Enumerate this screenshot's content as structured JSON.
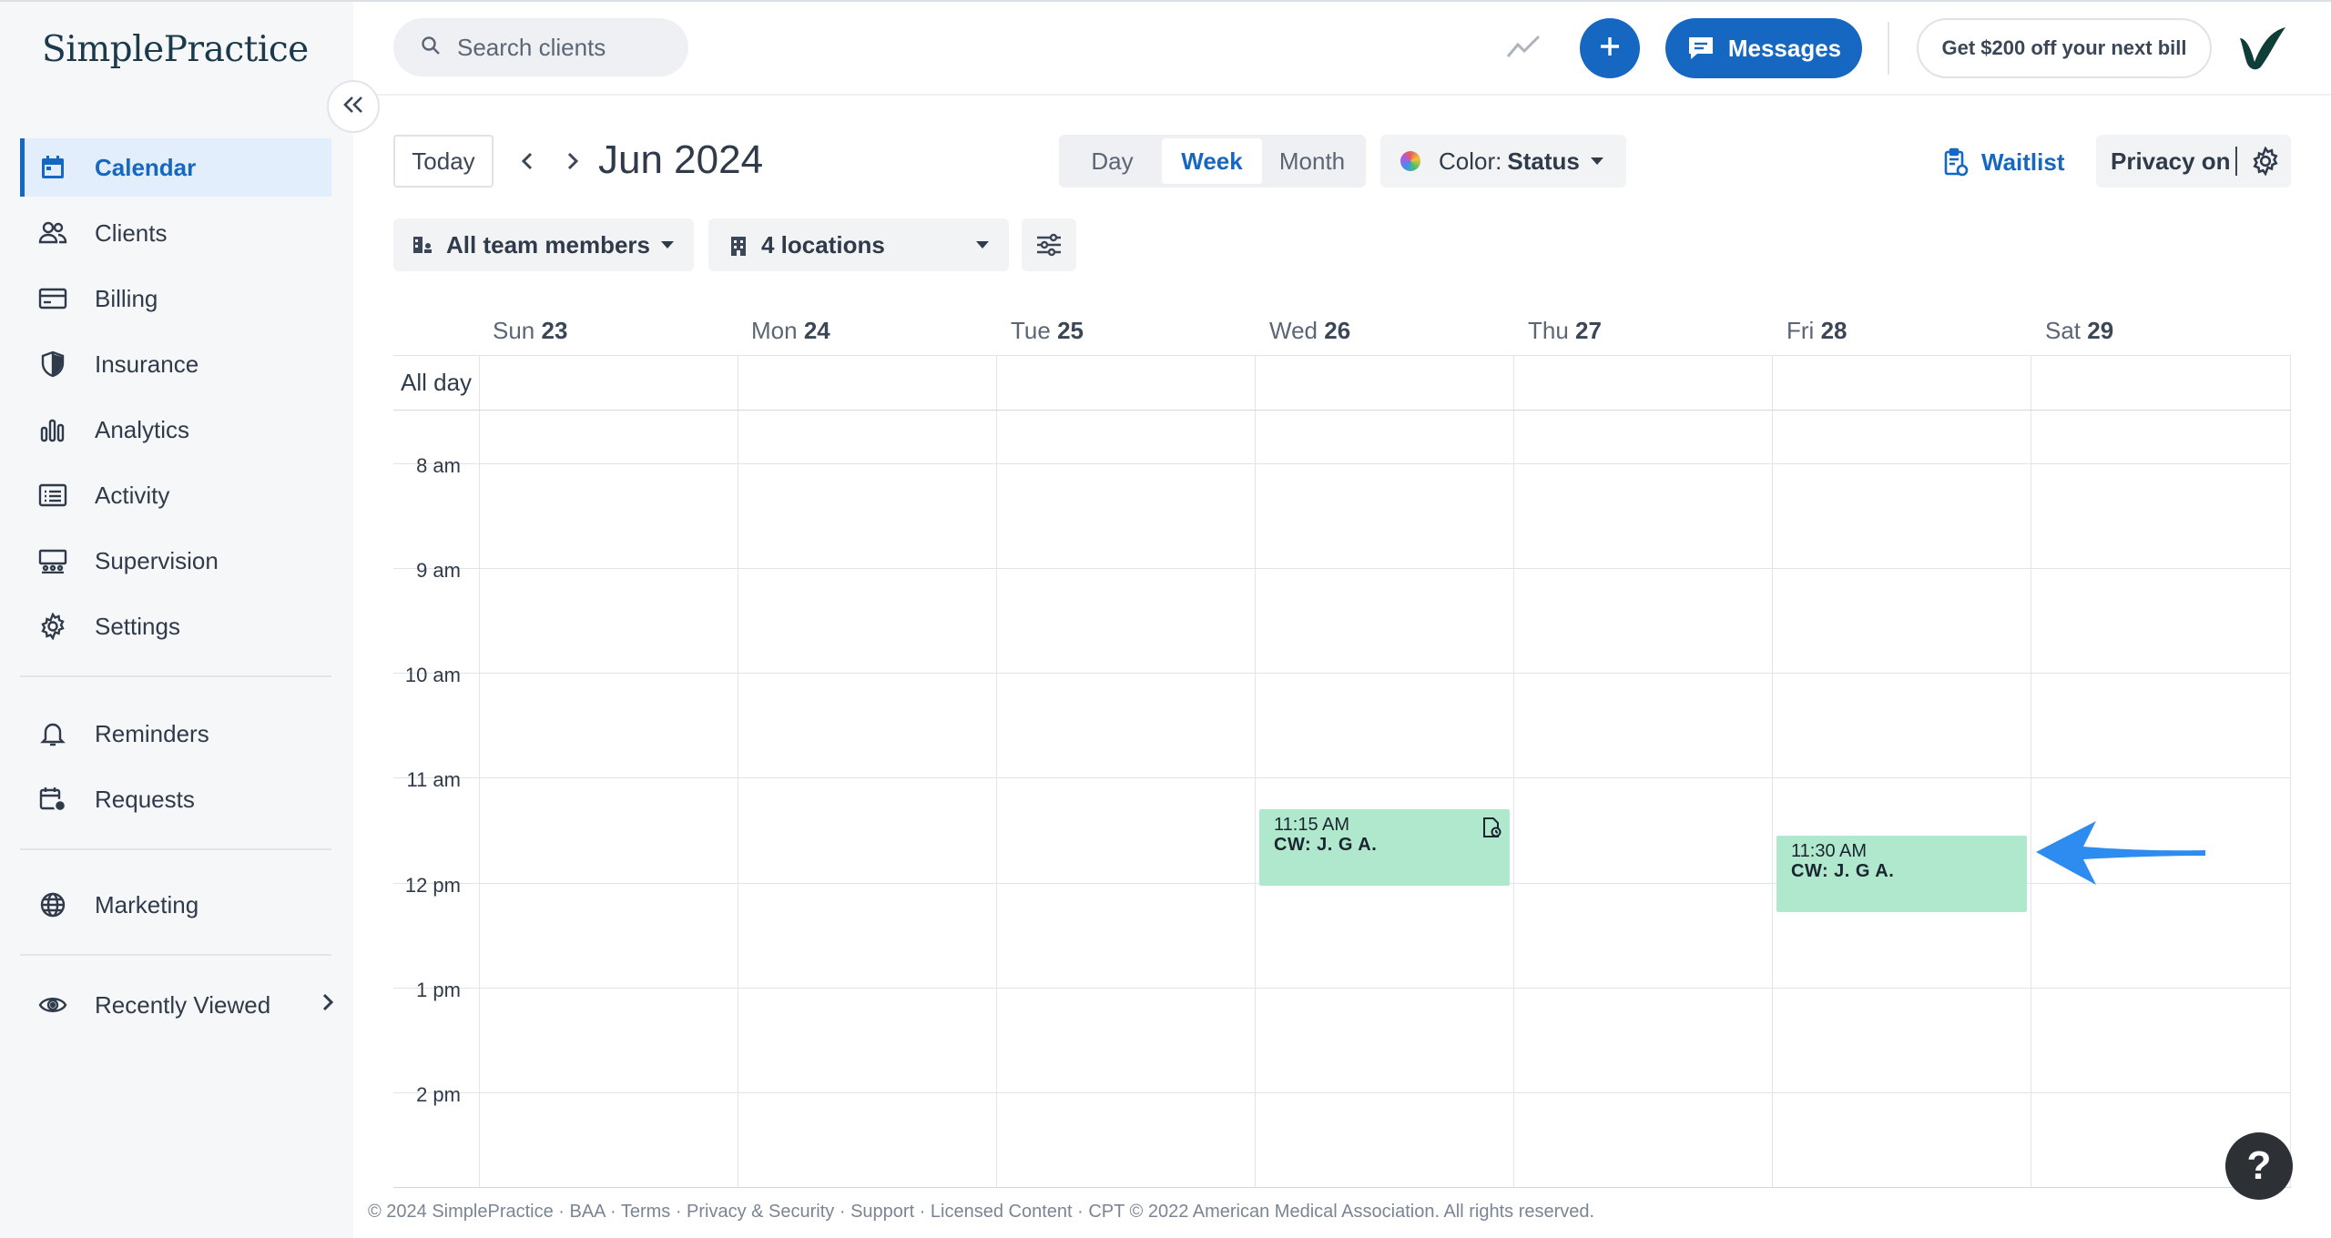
{
  "app": {
    "logo_text": "SimplePractice",
    "brand_color": "#1667c2"
  },
  "sidebar": {
    "items": [
      {
        "label": "Calendar",
        "icon": "calendar-icon",
        "active": true
      },
      {
        "label": "Clients",
        "icon": "clients-icon"
      },
      {
        "label": "Billing",
        "icon": "billing-icon"
      },
      {
        "label": "Insurance",
        "icon": "shield-icon"
      },
      {
        "label": "Analytics",
        "icon": "bar-chart-icon"
      },
      {
        "label": "Activity",
        "icon": "list-icon"
      },
      {
        "label": "Supervision",
        "icon": "supervision-icon"
      },
      {
        "label": "Settings",
        "icon": "gear-icon"
      },
      {
        "label": "Reminders",
        "icon": "bell-icon"
      },
      {
        "label": "Requests",
        "icon": "calendar-request-icon"
      },
      {
        "label": "Marketing",
        "icon": "globe-icon"
      },
      {
        "label": "Recently Viewed",
        "icon": "eye-icon"
      }
    ]
  },
  "topbar": {
    "search_placeholder": "Search clients",
    "messages_label": "Messages",
    "promo_label": "Get $200 off your next bill"
  },
  "toolbar": {
    "today_label": "Today",
    "range_title": "Jun 2024",
    "views": [
      "Day",
      "Week",
      "Month"
    ],
    "active_view": "Week",
    "color_prefix": "Color: ",
    "color_value": "Status",
    "waitlist_label": "Waitlist",
    "privacy_label": "Privacy on",
    "team_filter": "All team members",
    "location_filter": "4 locations"
  },
  "calendar": {
    "days": [
      {
        "dow": "Sun",
        "date": "23"
      },
      {
        "dow": "Mon",
        "date": "24"
      },
      {
        "dow": "Tue",
        "date": "25"
      },
      {
        "dow": "Wed",
        "date": "26"
      },
      {
        "dow": "Thu",
        "date": "27"
      },
      {
        "dow": "Fri",
        "date": "28"
      },
      {
        "dow": "Sat",
        "date": "29"
      }
    ],
    "allday_label": "All day",
    "hours": [
      "8 am",
      "9 am",
      "10 am",
      "11 am",
      "12 pm",
      "1 pm",
      "2 pm"
    ],
    "events": [
      {
        "time": "11:15 AM",
        "title": "CW: J. G A.",
        "day": "Wed 26",
        "color": "#b0e8cd"
      },
      {
        "time": "11:30 AM",
        "title": "CW: J. G A.",
        "day": "Fri 28",
        "color": "#b0e8cd"
      }
    ]
  },
  "footer": {
    "text": "© 2024 SimplePractice · BAA · Terms · Privacy & Security · Support · Licensed Content · CPT © 2022 American Medical Association. All rights reserved."
  },
  "help_label": "?"
}
